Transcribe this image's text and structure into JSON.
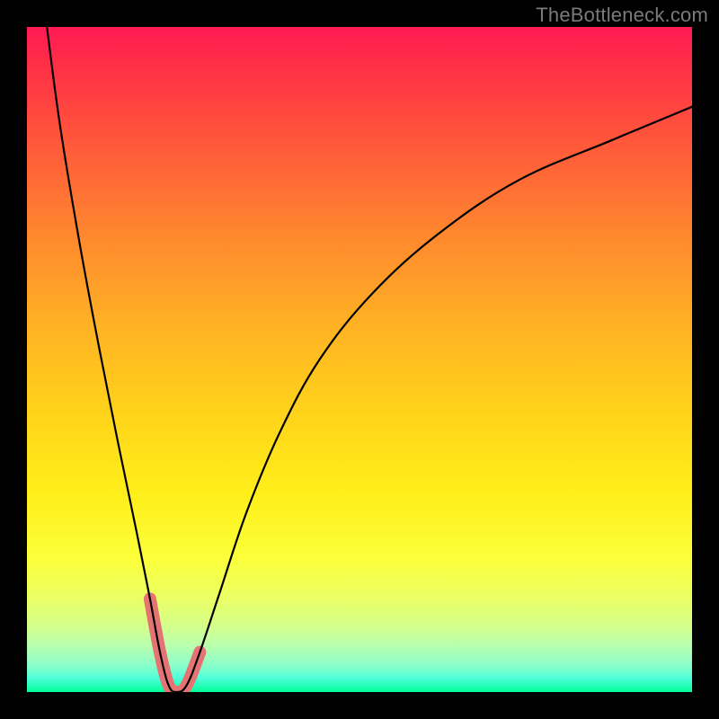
{
  "watermark": "TheBottleneck.com",
  "chart_data": {
    "type": "line",
    "title": "",
    "xlabel": "",
    "ylabel": "",
    "xlim": [
      0,
      100
    ],
    "ylim": [
      0,
      100
    ],
    "gradient_stops": [
      {
        "pct": 0,
        "color": "#ff1a53"
      },
      {
        "pct": 6,
        "color": "#ff3046"
      },
      {
        "pct": 18,
        "color": "#ff5a3a"
      },
      {
        "pct": 32,
        "color": "#ff8a2e"
      },
      {
        "pct": 45,
        "color": "#ffb224"
      },
      {
        "pct": 58,
        "color": "#ffd31a"
      },
      {
        "pct": 70,
        "color": "#ffee1a"
      },
      {
        "pct": 80,
        "color": "#fbff3a"
      },
      {
        "pct": 86,
        "color": "#eaff66"
      },
      {
        "pct": 90,
        "color": "#d4ff8a"
      },
      {
        "pct": 93,
        "color": "#b8ffad"
      },
      {
        "pct": 96,
        "color": "#8bffcb"
      },
      {
        "pct": 98,
        "color": "#4cffd8"
      },
      {
        "pct": 100,
        "color": "#00ff99"
      }
    ],
    "series": [
      {
        "name": "bottleneck-curve",
        "x": [
          3,
          5,
          8,
          11,
          14,
          16.5,
          18.5,
          20,
          21.3,
          22.5,
          24,
          26,
          29,
          33,
          38,
          44,
          52,
          62,
          74,
          88,
          100
        ],
        "y": [
          100,
          85,
          67,
          51,
          36,
          24,
          14,
          6,
          1,
          0,
          1,
          6,
          15,
          27,
          39,
          50,
          60,
          69,
          77,
          83,
          88
        ]
      }
    ],
    "highlight_band": {
      "name": "salmon-highlight",
      "x": [
        18.5,
        20,
        21.3,
        22.5,
        24,
        26
      ],
      "y": [
        14,
        6,
        1,
        0,
        1,
        6
      ]
    },
    "minimum": {
      "x": 22.5,
      "y": 0
    }
  }
}
